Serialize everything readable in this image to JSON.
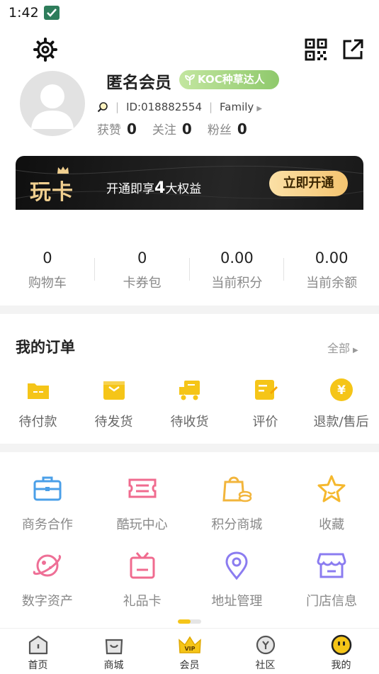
{
  "status_bar": {
    "time": "1:42"
  },
  "header": {
    "settings_icon": "gear-icon",
    "qr_icon": "qr-code-icon",
    "share_icon": "share-external-icon"
  },
  "profile": {
    "name": "匿名会员",
    "badge": "KOC种草达人",
    "id_text": "ID:018882554",
    "family": "Family",
    "stats": [
      {
        "label": "获赞",
        "value": "0"
      },
      {
        "label": "关注",
        "value": "0"
      },
      {
        "label": "粉丝",
        "value": "0"
      }
    ]
  },
  "vip_banner": {
    "logo": "玩卡",
    "desc_prefix": "开通即享",
    "desc_number": "4",
    "desc_suffix": "大权益",
    "button": "立即开通",
    "colors": {
      "gold": "#f4c470",
      "dark": "#1a1a1a"
    }
  },
  "assets": [
    {
      "value": "0",
      "label": "购物车"
    },
    {
      "value": "0",
      "label": "卡券包"
    },
    {
      "value": "0.00",
      "label": "当前积分"
    },
    {
      "value": "0.00",
      "label": "当前余额"
    }
  ],
  "orders": {
    "title": "我的订单",
    "all": "全部",
    "items": [
      {
        "label": "待付款",
        "icon": "wallet-icon"
      },
      {
        "label": "待发货",
        "icon": "package-icon"
      },
      {
        "label": "待收货",
        "icon": "truck-icon"
      },
      {
        "label": "评价",
        "icon": "review-icon"
      },
      {
        "label": "退款/售后",
        "icon": "yen-icon"
      }
    ],
    "accent": "#f5c518"
  },
  "services": [
    {
      "label": "商务合作",
      "icon": "briefcase-icon",
      "color": "#4a9fe8"
    },
    {
      "label": "酷玩中心",
      "icon": "ticket-icon",
      "color": "#f06b8f"
    },
    {
      "label": "积分商城",
      "icon": "shopping-bag-icon",
      "color": "#f2b53c"
    },
    {
      "label": "收藏",
      "icon": "star-icon",
      "color": "#f5b82e"
    },
    {
      "label": "数字资产",
      "icon": "planet-icon",
      "color": "#ee6f96"
    },
    {
      "label": "礼品卡",
      "icon": "gift-card-icon",
      "color": "#f06b8f"
    },
    {
      "label": "地址管理",
      "icon": "location-pin-icon",
      "color": "#8b7cf0"
    },
    {
      "label": "门店信息",
      "icon": "store-icon",
      "color": "#8b7cf0"
    }
  ],
  "scroll_position": 0.55,
  "tabbar": [
    {
      "label": "首页",
      "icon": "home-icon"
    },
    {
      "label": "商城",
      "icon": "bag-smile-icon"
    },
    {
      "label": "会员",
      "icon": "vip-crown-icon"
    },
    {
      "label": "社区",
      "icon": "community-icon"
    },
    {
      "label": "我的",
      "icon": "profile-smile-icon"
    }
  ]
}
